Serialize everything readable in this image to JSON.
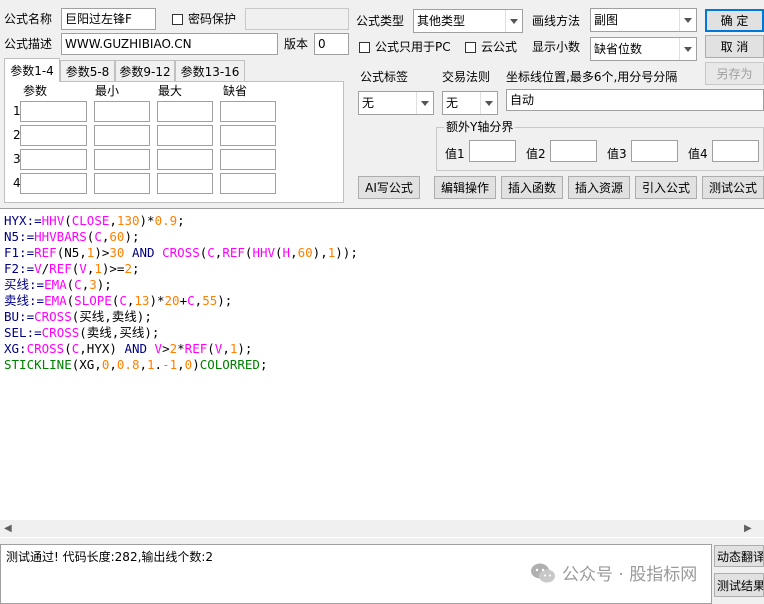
{
  "formula": {
    "name_label": "公式名称",
    "name_value": "巨阳过左锋F",
    "password_label": "密码保护",
    "desc_label": "公式描述",
    "desc_value": "WWW.GUZHIBIAO.CN",
    "version_label": "版本",
    "version_value": "0"
  },
  "type": {
    "label": "公式类型",
    "value": "其他类型",
    "pc_only_label": "公式只用于PC",
    "cloud_label": "云公式"
  },
  "draw": {
    "label": "画线方法",
    "value": "副图",
    "decimals_label": "显示小数",
    "decimals_value": "缺省位数"
  },
  "buttons": {
    "ok": "确  定",
    "cancel": "取  消",
    "save_as": "另存为",
    "ai": "AI写公式",
    "edit": "编辑操作",
    "insert_fn": "插入函数",
    "insert_res": "插入资源",
    "import": "引入公式",
    "test": "测试公式",
    "translate": "动态翻译",
    "test_result": "测试结果"
  },
  "tabs": [
    "参数1-4",
    "参数5-8",
    "参数9-12",
    "参数13-16"
  ],
  "params": {
    "headers": [
      "参数",
      "最小",
      "最大",
      "缺省"
    ],
    "rows": [
      "1",
      "2",
      "3",
      "4"
    ]
  },
  "labels_section": {
    "tag_label": "公式标签",
    "tag_value": "无",
    "trade_label": "交易法则",
    "trade_value": "无",
    "coord_label": "坐标线位置,最多6个,用分号分隔",
    "coord_value": "自动",
    "yaxis_label": "额外Y轴分界",
    "v1": "值1",
    "v2": "值2",
    "v3": "值3",
    "v4": "值4"
  },
  "status": {
    "message": "测试通过! 代码长度:282,输出线个数:2"
  },
  "watermark": {
    "text": "公众号 · 股指标网"
  }
}
